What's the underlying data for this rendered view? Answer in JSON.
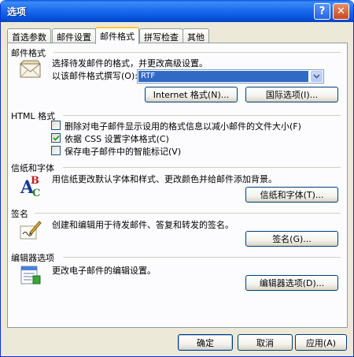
{
  "window": {
    "title": "选项",
    "help_glyph": "?",
    "close_glyph": "✕"
  },
  "tabs": [
    {
      "label": "首选参数"
    },
    {
      "label": "邮件设置"
    },
    {
      "label": "邮件格式"
    },
    {
      "label": "拼写检查"
    },
    {
      "label": "其他"
    }
  ],
  "mail_format": {
    "header": "邮件格式",
    "desc": "选择待发邮件的格式，并更改高级设置。",
    "compose_label": "以该邮件格式撰写(O):",
    "compose_value": "RTF",
    "internet_button": "Internet 格式(N)...",
    "intl_button": "国际选项(I)..."
  },
  "html_format": {
    "header": "HTML 格式",
    "options": [
      {
        "label": "删除对电子邮件显示设用的格式信息以减小邮件的文件大小(F)",
        "checked": false
      },
      {
        "label": "依据 CSS 设置字体格式(C)",
        "checked": true
      },
      {
        "label": "保存电子邮件中的智能标记(V)",
        "checked": false
      }
    ]
  },
  "stationery": {
    "header": "信纸和字体",
    "desc": "用信纸更改默认字体和样式、更改颜色并给邮件添加背景。",
    "button": "信纸和字体(T)..."
  },
  "signature": {
    "header": "签名",
    "desc": "创建和编辑用于待发邮件、答复和转发的签名。",
    "button": "签名(G)..."
  },
  "editor": {
    "header": "编辑器选项",
    "desc": "更改电子邮件的编辑设置。",
    "button": "编辑器选项(D)..."
  },
  "footer": {
    "ok": "确定",
    "cancel": "取消",
    "apply": "应用(A)"
  }
}
